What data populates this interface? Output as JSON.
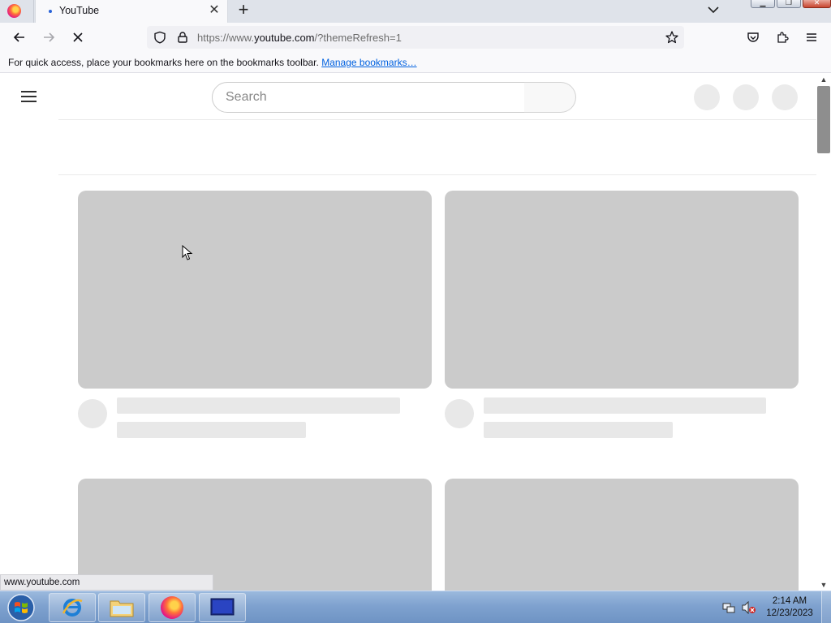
{
  "browser": {
    "tab": {
      "title": "YouTube"
    },
    "url": {
      "prefix": "https://www.",
      "domain": "youtube.com",
      "suffix": "/?themeRefresh=1"
    },
    "bookmarks_bar": {
      "message": "For quick access, place your bookmarks here on the bookmarks toolbar.",
      "link": "Manage bookmarks…"
    },
    "status_url": "www.youtube.com"
  },
  "youtube": {
    "search": {
      "placeholder": "Search"
    }
  },
  "taskbar": {
    "time": "2:14 AM",
    "date": "12/23/2023"
  },
  "icons": {
    "firefox": "firefox-icon",
    "back": "back-arrow-icon",
    "forward": "forward-arrow-icon",
    "stop": "stop-loading-icon",
    "shield": "tracking-shield-icon",
    "lock": "lock-icon",
    "star": "bookmark-star-icon",
    "pocket": "pocket-icon",
    "extensions": "extensions-icon",
    "menu": "hamburger-menu-icon"
  },
  "colors": {
    "skeleton": "#cbcbcb",
    "link": "#0061e0",
    "taskbar": "#7fa2cf"
  }
}
